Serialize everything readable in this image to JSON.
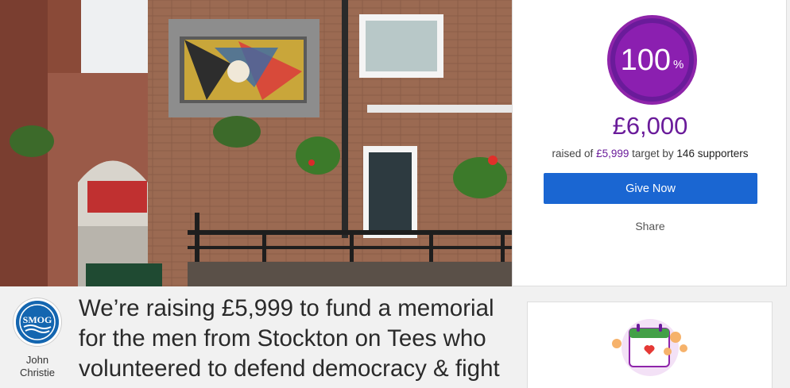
{
  "hero": {
    "image_description_icon": "building-photo"
  },
  "donation": {
    "percent": "100",
    "percent_sign": "%",
    "percent_value": 100,
    "amount_raised": "£6,000",
    "raised_prefix": "raised of",
    "target": "£5,999",
    "target_word": "target by",
    "supporters": "146 supporters",
    "give_button": "Give Now",
    "share_label": "Share",
    "colors": {
      "accent": "#6a1b9a",
      "button": "#1a66d2"
    }
  },
  "owner": {
    "logo_text": "SMOG",
    "name_first": "John",
    "name_last": "Christie"
  },
  "headline": {
    "line1": "We’re raising £5,999 to fund a memorial",
    "line2": "for the men from Stockton on Tees who",
    "line3": "volunteered to defend democracy & fight"
  },
  "side_card": {
    "icon": "calendar-heart-icon"
  }
}
